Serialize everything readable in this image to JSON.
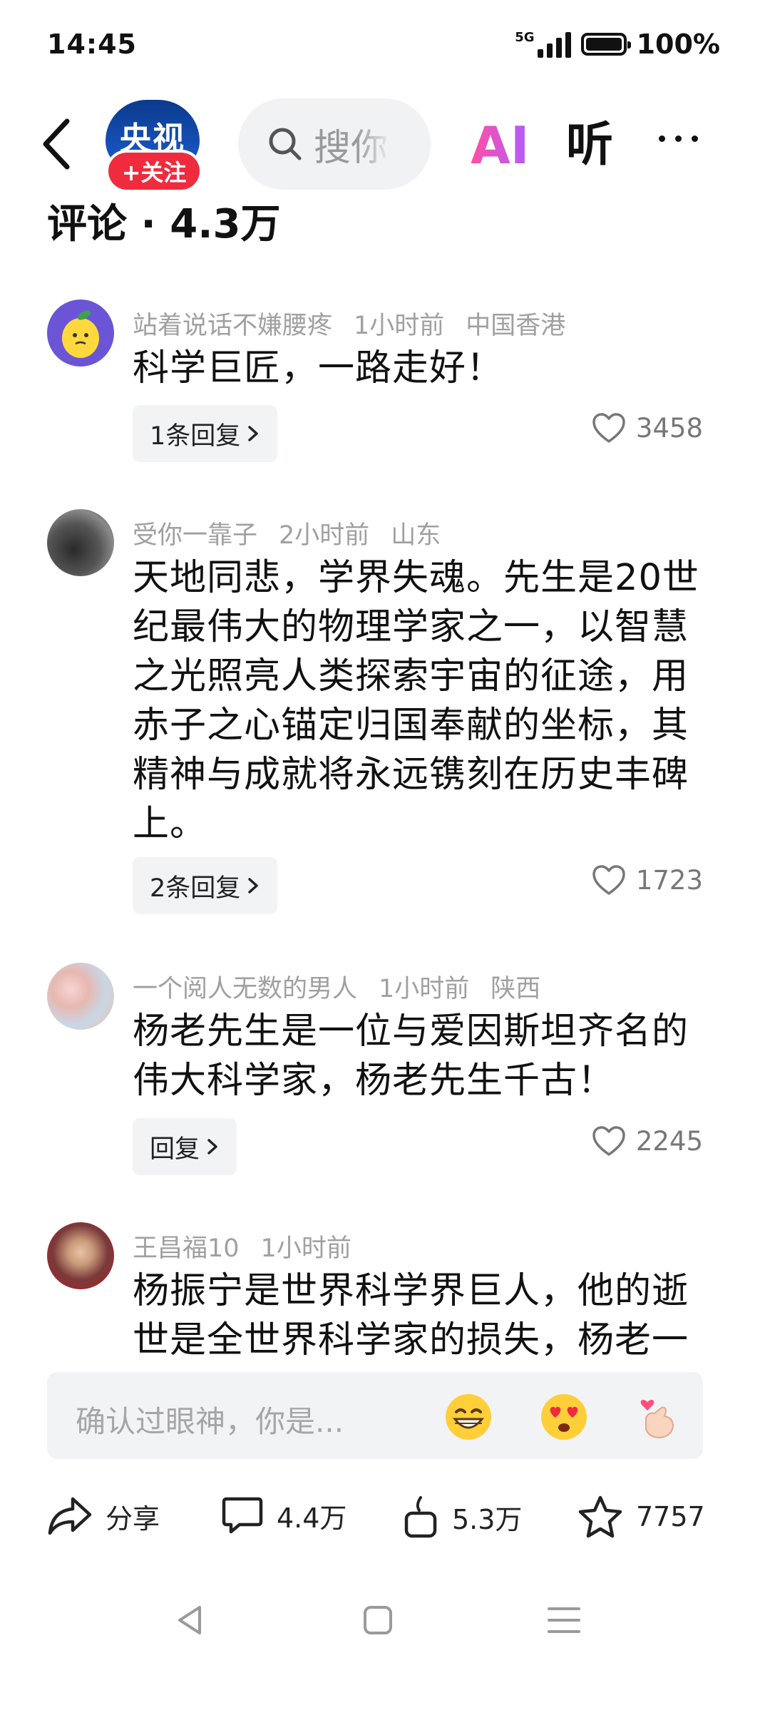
{
  "status_bar": {
    "time": "14:45",
    "network": "5G",
    "battery": "100%"
  },
  "header": {
    "logo_text": "央视",
    "follow_label": "+关注",
    "search_placeholder": "搜你",
    "ai_label": "AI",
    "listen_label": "听"
  },
  "comments_title": "评论 · 4.3万",
  "comments": [
    {
      "user": "站着说话不嫌腰疼",
      "time": "1小时前",
      "location": "中国香港",
      "text": "科学巨匠，一路走好！",
      "reply_label": "1条回复",
      "likes": "3458"
    },
    {
      "user": "受你一靠子",
      "time": "2小时前",
      "location": "山东",
      "text": "天地同悲，学界失魂。先生是20世纪最伟大的物理学家之一，以智慧之光照亮人类探索宇宙的征途，用赤子之心锚定归国奉献的坐标，其精神与成就将永远镌刻在历史丰碑上。",
      "reply_label": "2条回复",
      "likes": "1723"
    },
    {
      "user": "一个阅人无数的男人",
      "time": "1小时前",
      "location": "陕西",
      "text": "杨老先生是一位与爱因斯坦齐名的伟大科学家，杨老先生千古！",
      "reply_label": "回复",
      "likes": "2245"
    },
    {
      "user": "王昌福10",
      "time": "1小时前",
      "location": "",
      "text": "杨振宁是世界科学界巨人，他的逝世是全世界科学家的损失，杨老一"
    }
  ],
  "input": {
    "placeholder": "确认过眼神，你是..."
  },
  "actions": {
    "share_label": "分享",
    "comment_count": "4.4万",
    "like_count": "5.3万",
    "favorite_count": "7757"
  },
  "colors": {
    "follow_red": "#ef2b3d",
    "logo_blue": "#1c5ccf",
    "meta_gray": "#a0a0a0"
  }
}
